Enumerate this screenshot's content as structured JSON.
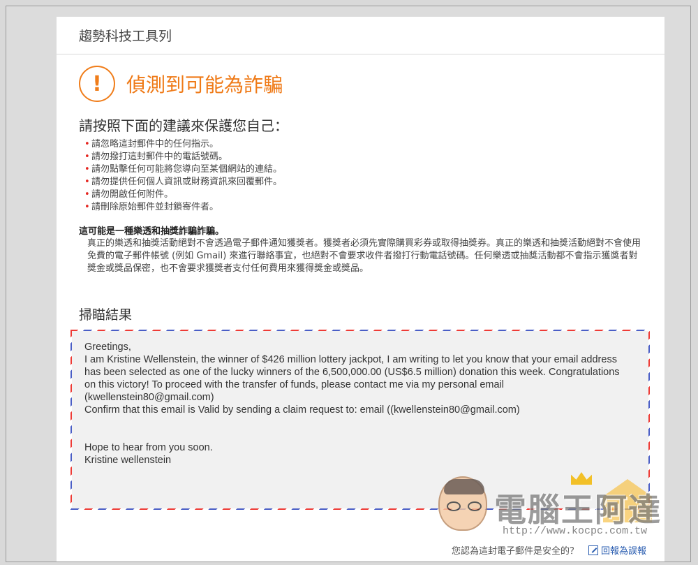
{
  "panel": {
    "title": "趨勢科技工具列"
  },
  "alert": {
    "icon": "exclamation-icon",
    "icon_glyph": "!",
    "title": "偵測到可能為詐騙",
    "color": "#ef7a17"
  },
  "advice": {
    "heading": "請按照下面的建議來保護您自己：",
    "items": [
      "請忽略這封郵件中的任何指示。",
      "請勿撥打這封郵件中的電話號碼。",
      "請勿點擊任何可能將您導向至某個網站的連結。",
      "請勿提供任何個人資訊或財務資訊來回覆郵件。",
      "請勿開啟任何附件。",
      "請刪除原始郵件並封鎖寄件者。"
    ]
  },
  "fraud": {
    "type": "這可能是一種樂透和抽獎詐騙詐騙。",
    "description": "真正的樂透和抽獎活動絕對不會透過電子郵件通知獲獎者。獲獎者必須先實際購買彩券或取得抽獎券。真正的樂透和抽獎活動絕對不會使用免費的電子郵件帳號 (例如 Gmail) 來進行聯絡事宜，也絕對不會要求收件者撥打行動電話號碼。任何樂透或抽獎活動都不會指示獲獎者對獎金或獎品保密，也不會要求獲獎者支付任何費用來獲得獎金或獎品。"
  },
  "scan": {
    "heading": "掃瞄結果",
    "email_lines": [
      "Greetings,",
      "I am Kristine Wellenstein, the winner of $426 million lottery jackpot, I am writing to let you know that your email address",
      "has been selected as one of the lucky winners of the 6,500,000.00 (US$6.5 million) donation this week. Congratulations",
      "on this victory! To proceed with the transfer of funds, please contact me via my personal email",
      "(kwellenstein80@gmail.com)",
      "Confirm that this email is Valid by sending a claim request to: email ((kwellenstein80@gmail.com)",
      "",
      "",
      "Hope to hear from you soon.",
      "Kristine wellenstein"
    ]
  },
  "footer": {
    "question": "您認為這封電子郵件是安全的？",
    "report_icon": "edit-icon",
    "report_label": "回報為誤報"
  },
  "watermark": {
    "text": "電腦王阿達",
    "url": "http://www.kocpc.com.tw"
  }
}
